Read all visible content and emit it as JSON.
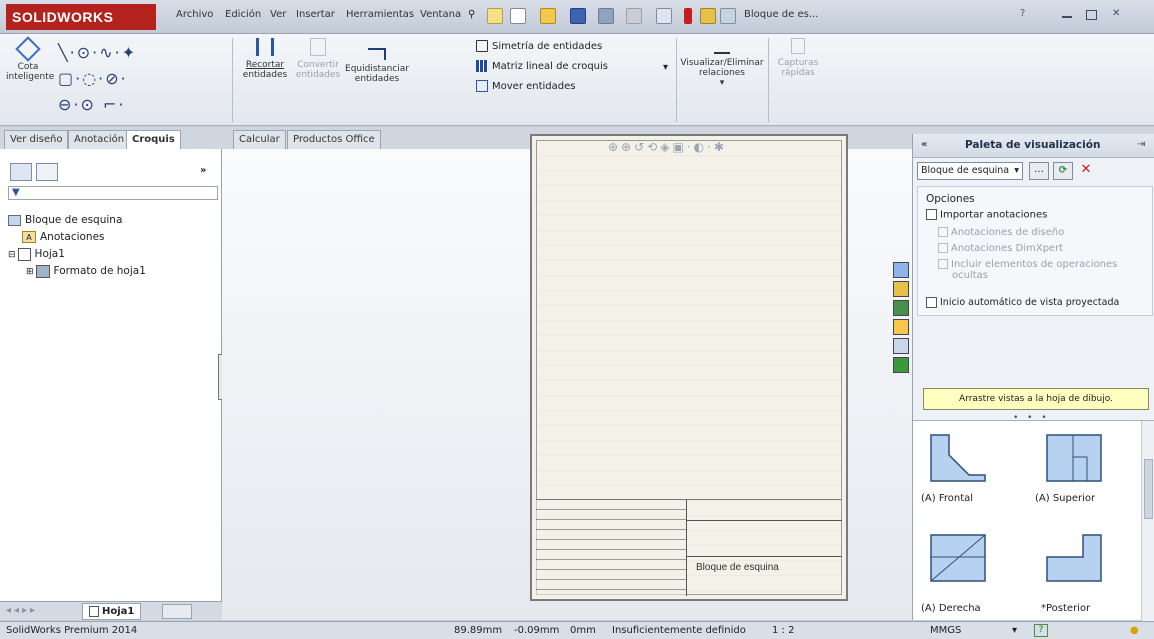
{
  "titlebar": {
    "logo": "SOLIDWORKS",
    "menus": [
      "Archivo",
      "Edición",
      "Ver",
      "Insertar",
      "Herramientas",
      "Ventana"
    ],
    "document_title": "Bloque de es..."
  },
  "ribbon": {
    "smart_dimension": [
      "Cota",
      "inteligente"
    ],
    "trim": [
      "Recortar",
      "entidades"
    ],
    "convert": [
      "Convertir",
      "entidades"
    ],
    "offset": [
      "Equidistanciar",
      "entidades"
    ],
    "mirror": "Simetría de entidades",
    "linear_pattern": "Matriz lineal de croquis",
    "move": "Mover entidades",
    "relations": [
      "Visualizar/Eliminar",
      "relaciones"
    ],
    "quick_snaps": [
      "Capturas",
      "rápidas"
    ]
  },
  "tabs": [
    "Ver diseño",
    "Anotación",
    "Croquis",
    "Calcular",
    "Productos Office"
  ],
  "tree": {
    "root": "Bloque de esquina",
    "annotations": "Anotaciones",
    "sheet": "Hoja1",
    "sheet_format": "Formato de hoja1"
  },
  "sheet_tab": "Hoja1",
  "titleblock_text": "Bloque de esquina",
  "palette": {
    "title": "Paleta de visualización",
    "selected_model": "Bloque de esquina",
    "options_label": "Opciones",
    "import_annotations": "Importar anotaciones",
    "design_annotations": "Anotaciones de diseño",
    "dimxpert_annotations": "Anotaciones DimXpert",
    "hidden_features": [
      "Incluir elementos de operaciones",
      "ocultas"
    ],
    "auto_projected": "Inicio automático de vista proyectada",
    "drag_hint": "Arrastre vistas a la hoja de dibujo.",
    "views": [
      "(A) Frontal",
      "(A) Superior",
      "(A) Derecha",
      "*Posterior"
    ]
  },
  "statusbar": {
    "product": "SolidWorks Premium 2014",
    "x": "89.89mm",
    "y": "-0.09mm",
    "z": "0mm",
    "state": "Insuficientemente definido",
    "scale": "1 : 2",
    "units": "MMGS"
  },
  "colors": {
    "brand": "#b3221c",
    "hint_bg": "#ffffc0",
    "close_red": "#d11b1b"
  }
}
